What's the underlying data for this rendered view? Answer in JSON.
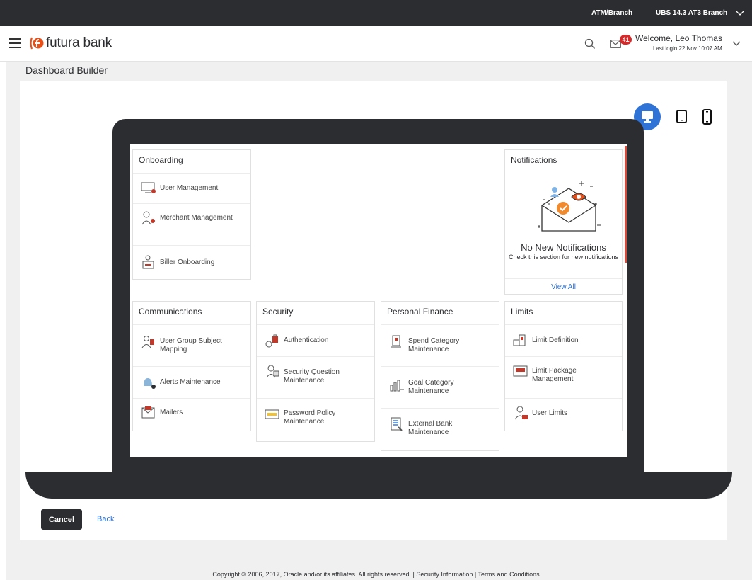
{
  "topbar": {
    "branch_label": "ATM/Branch",
    "entity_label": "UBS 14.3 AT3 Branch"
  },
  "header": {
    "brand": "futura bank",
    "notification_count": "41",
    "welcome": "Welcome, Leo Thomas",
    "last_login": "Last login 22 Nov 10:07 AM"
  },
  "page": {
    "title": "Dashboard Builder"
  },
  "colors": {
    "dark": "#2c2d31",
    "accent": "#2f73d6",
    "badge": "#d7292a",
    "brand": "#e8501a"
  },
  "device_toggles": [
    {
      "name": "desktop",
      "icon": "desktop-icon",
      "selected": true
    },
    {
      "name": "tablet",
      "icon": "tablet-icon",
      "selected": false
    },
    {
      "name": "mobile",
      "icon": "mobile-icon",
      "selected": false
    }
  ],
  "widgets": {
    "onboarding": {
      "title": "Onboarding",
      "items": [
        {
          "label": "User Management",
          "icon": "monitor-user-icon"
        },
        {
          "label": "Merchant Management",
          "icon": "merchant-icon"
        },
        {
          "label": "Biller Onboarding",
          "icon": "biller-icon"
        }
      ]
    },
    "notifications": {
      "title": "Notifications",
      "heading": "No New Notifications",
      "subtext": "Check this section for new notifications",
      "link": "View All"
    },
    "communications": {
      "title": "Communications",
      "items": [
        {
          "label": "User Group Subject Mapping",
          "icon": "user-group-icon"
        },
        {
          "label": "Alerts Maintenance",
          "icon": "bell-icon"
        },
        {
          "label": "Mailers",
          "icon": "mailer-icon"
        }
      ]
    },
    "security": {
      "title": "Security",
      "items": [
        {
          "label": "Authentication",
          "icon": "authentication-icon"
        },
        {
          "label": "Security Question Maintenance",
          "icon": "security-question-icon"
        },
        {
          "label": "Password Policy Maintenance",
          "icon": "password-policy-icon"
        }
      ]
    },
    "personal_finance": {
      "title": "Personal Finance",
      "items": [
        {
          "label": "Spend Category Maintenance",
          "icon": "spend-category-icon"
        },
        {
          "label": "Goal Category Maintenance",
          "icon": "goal-category-icon"
        },
        {
          "label": "External Bank Maintenance",
          "icon": "external-bank-icon"
        }
      ]
    },
    "limits": {
      "title": "Limits",
      "items": [
        {
          "label": "Limit Definition",
          "icon": "limit-definition-icon"
        },
        {
          "label": "Limit Package Management",
          "icon": "limit-package-icon"
        },
        {
          "label": "User Limits",
          "icon": "user-limits-icon"
        }
      ]
    }
  },
  "actions": {
    "cancel": "Cancel",
    "back": "Back"
  },
  "footer": {
    "copyright": "Copyright © 2006, 2017, Oracle and/or its affiliates. All rights reserved. | Security Information | Terms and Conditions"
  }
}
